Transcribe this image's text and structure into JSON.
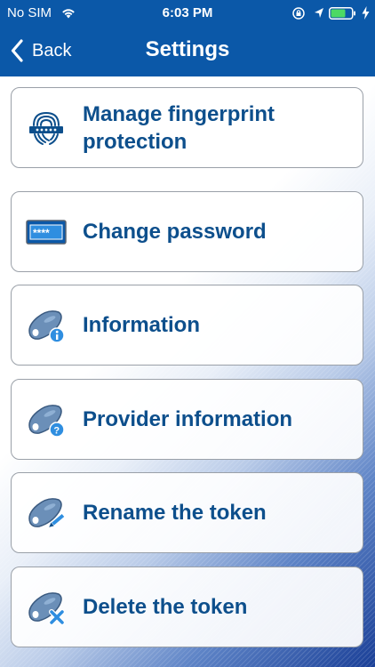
{
  "status_bar": {
    "carrier": "No SIM",
    "time": "6:03 PM"
  },
  "nav": {
    "back_label": "Back",
    "title": "Settings"
  },
  "menu": [
    {
      "label": "Manage fingerprint protection",
      "icon": "fingerprint-icon"
    },
    {
      "label": "Change password",
      "icon": "password-field-icon"
    },
    {
      "label": "Information",
      "icon": "token-info-icon"
    },
    {
      "label": "Provider information",
      "icon": "token-question-icon"
    },
    {
      "label": "Rename the token",
      "icon": "token-rename-icon"
    },
    {
      "label": "Delete the token",
      "icon": "token-delete-icon"
    }
  ],
  "colors": {
    "nav_bar": "#0b58a8",
    "label_text": "#0d4f8c",
    "border": "#9aa0a8"
  }
}
